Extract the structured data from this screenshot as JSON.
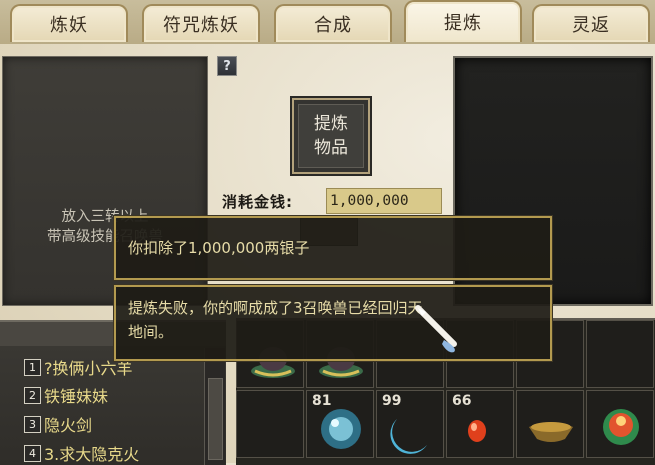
{
  "tabs": [
    {
      "label": "炼妖",
      "active": false
    },
    {
      "label": "符咒炼妖",
      "active": false
    },
    {
      "label": "合成",
      "active": false
    },
    {
      "label": "提炼",
      "active": true
    },
    {
      "label": "灵返",
      "active": false
    }
  ],
  "help": {
    "label": "?"
  },
  "left_panel": {
    "hint_line1": "放入三转以上",
    "hint_line2": "带高级技能召唤兽"
  },
  "refine": {
    "slot_line1": "提炼",
    "slot_line2": "物品"
  },
  "cost": {
    "label": "消耗金钱:",
    "value": "1,000,000"
  },
  "messages": {
    "deduct": "你扣除了1,000,000两银子",
    "fail_line1": "提炼失败，你的啊成成了3召唤兽已经回归天",
    "fail_line2": "地间。"
  },
  "pet_list": [
    {
      "num": "1",
      "name": "?换俩小六羊"
    },
    {
      "num": "2",
      "name": "铁锤妹妹"
    },
    {
      "num": "3",
      "name": "隐火剑"
    },
    {
      "num": "4",
      "name": "3.求大隐克火"
    }
  ],
  "inventory": {
    "counts": [
      "81",
      "99",
      "66"
    ],
    "icons": [
      "hat-item-icon",
      "hat-item-icon",
      "crystal-orb-icon",
      "crescent-moon-icon",
      "red-gem-icon",
      "bowl-item-icon",
      "flame-orb-icon"
    ]
  },
  "colors": {
    "message_text": "#e7dca8",
    "list_text": "#e8d98a",
    "gold_border": "#b39a4f"
  }
}
